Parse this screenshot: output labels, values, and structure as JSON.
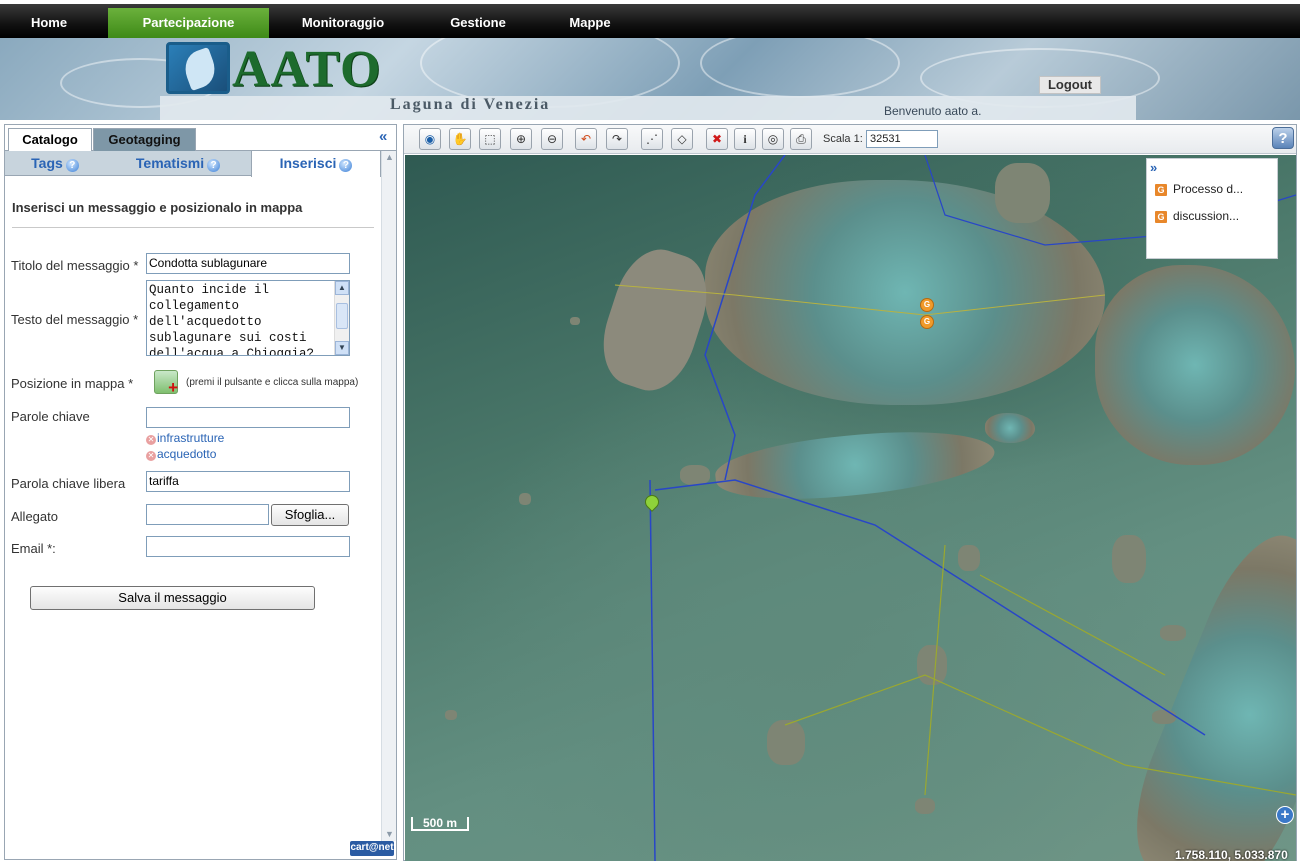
{
  "nav": {
    "items": [
      "Home",
      "Partecipazione",
      "Monitoraggio",
      "Gestione",
      "Mappe"
    ],
    "active": "Partecipazione"
  },
  "header": {
    "logo_text": "AATO",
    "subtitle": "Laguna di Venezia",
    "logout": "Logout",
    "welcome": "Benvenuto aato a."
  },
  "left": {
    "outer_tabs": [
      "Catalogo",
      "Geotagging"
    ],
    "collapse": "«",
    "inner_tabs": [
      "Tags",
      "Tematismi",
      "Inserisci"
    ],
    "help_glyph": "?",
    "form": {
      "title": "Inserisci un messaggio e posizionalo in mappa",
      "titolo_label": "Titolo del messaggio *",
      "titolo_value": "Condotta sublagunare",
      "testo_label": "Testo del messaggio *",
      "testo_value": "Quanto incide il collegamento dell'acquedotto sublagunare sui costi dell'acqua a Chioggia?",
      "posizione_label": "Posizione in mappa *",
      "posizione_hint": "(premi il pulsante e clicca sulla mappa)",
      "parole_label": "Parole chiave",
      "parole_value": "",
      "tags": [
        "infrastrutture",
        "acquedotto"
      ],
      "parola_libera_label": "Parola chiave libera",
      "parola_libera_value": "tariffa",
      "allegato_label": "Allegato",
      "allegato_value": "",
      "browse_button": "Sfoglia...",
      "email_label": "Email *:",
      "email_value": "",
      "save_button": "Salva il messaggio"
    },
    "footer_logo": "cart@net"
  },
  "map": {
    "scale_label": "Scala 1:",
    "scale_value": "32531",
    "help": "?",
    "overview_chevron": "»",
    "overview_items": [
      "Processo d...",
      "discussion..."
    ],
    "pin_labels": [
      "G",
      "G"
    ],
    "scalebar": "500 m",
    "coordinates": "1.758.110, 5.033.870",
    "zoom_in": "+"
  },
  "colors": {
    "nav_active": "#4f9c27",
    "link_blue": "#2a64b5",
    "pin_orange": "#f09a2a"
  }
}
